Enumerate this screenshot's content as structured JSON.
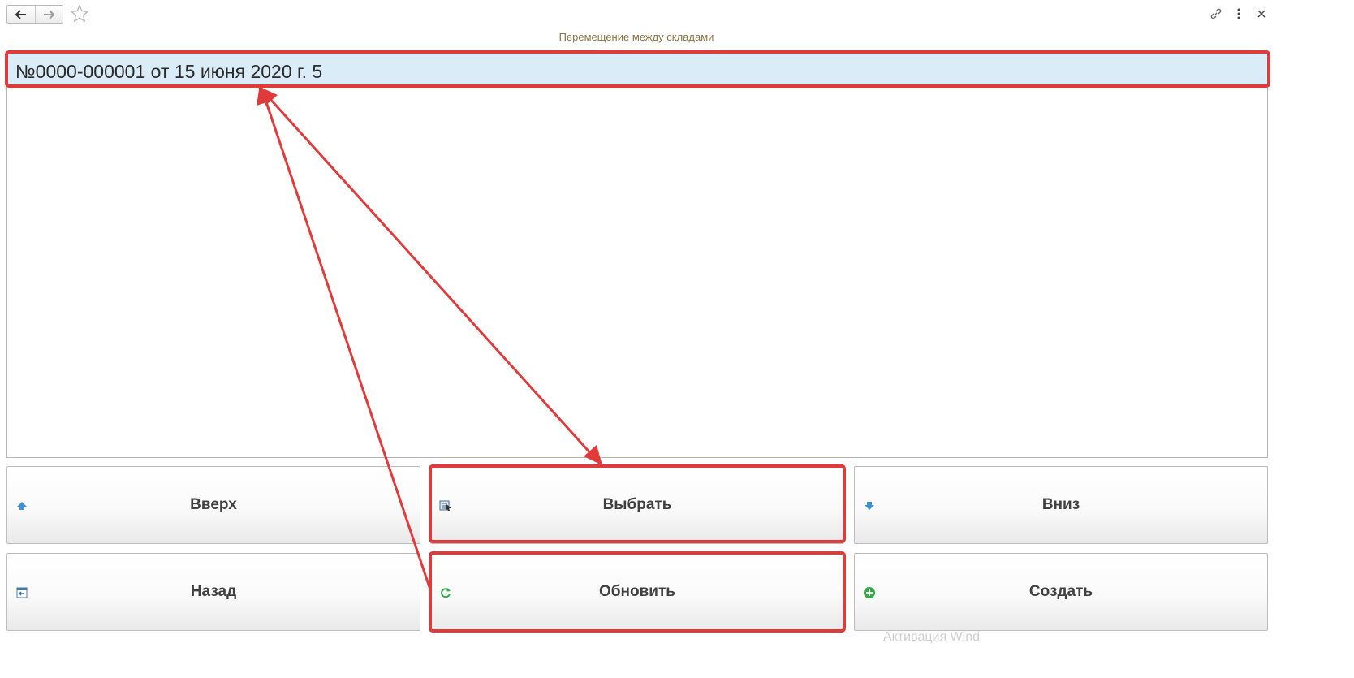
{
  "window": {
    "title": "Перемещение между складами"
  },
  "list": {
    "rows": [
      "№0000-000001 от 15 июня 2020 г. 5"
    ]
  },
  "buttons": {
    "up": "Вверх",
    "select": "Выбрать",
    "down": "Вниз",
    "back": "Назад",
    "refresh": "Обновить",
    "create": "Создать"
  },
  "icons": {
    "nav_back": "arrow-left-icon",
    "nav_forward": "arrow-right-icon",
    "favorite": "star-icon",
    "link": "link-icon",
    "more": "more-vertical-icon",
    "close": "close-icon",
    "up": "arrow-up-icon",
    "select": "select-icon",
    "down": "arrow-down-icon",
    "back": "back-icon",
    "refresh": "refresh-icon",
    "create": "plus-circle-icon"
  },
  "colors": {
    "selected_row": "#dbecf9",
    "title_text": "#8a7448",
    "annotation": "#e03a3a"
  },
  "watermark": "Активация Wind"
}
